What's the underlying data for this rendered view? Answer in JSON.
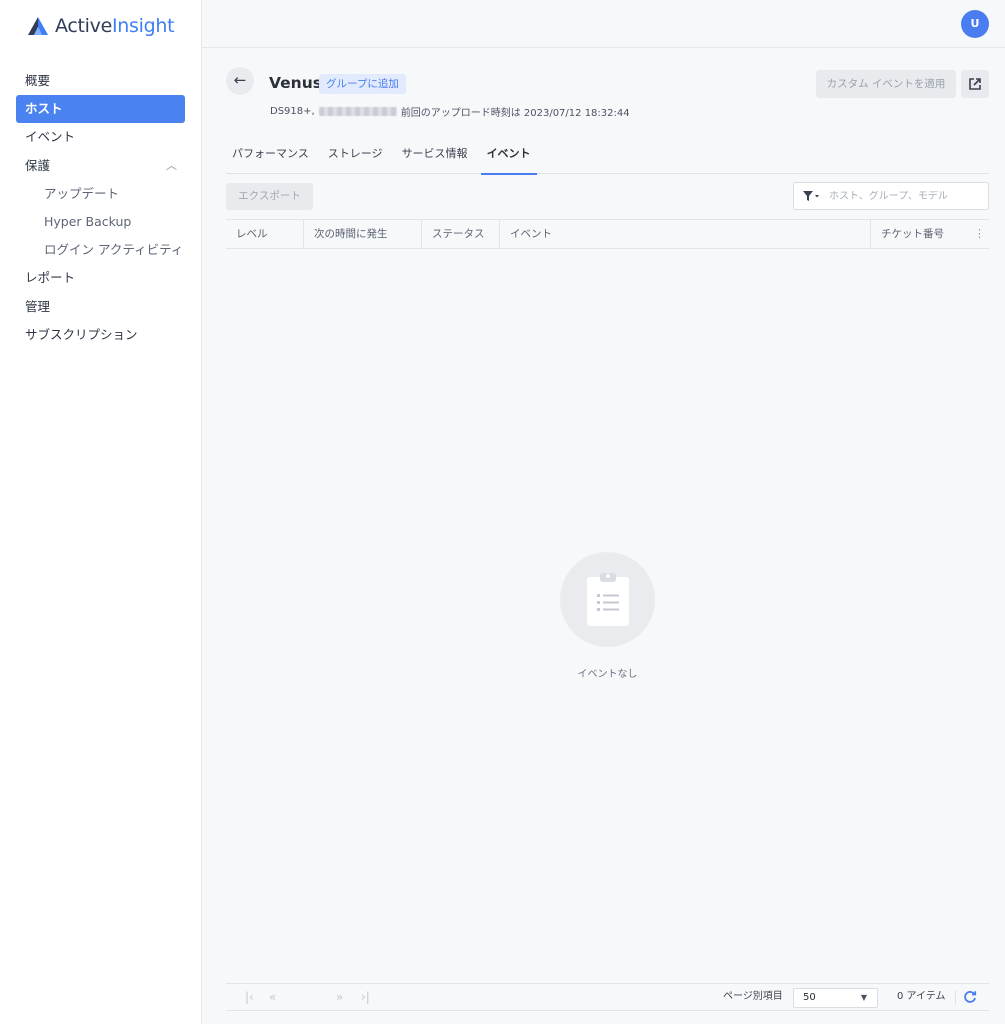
{
  "app": {
    "logo_part1": "Active",
    "logo_part2": "Insight",
    "accent": "#4a7df0"
  },
  "user": {
    "avatar_initial": "U"
  },
  "sidebar": {
    "items": [
      {
        "label": "概要"
      },
      {
        "label": "ホスト",
        "active": true
      },
      {
        "label": "イベント"
      },
      {
        "label": "保護",
        "expanded": true
      },
      {
        "label": "アップデート"
      },
      {
        "label": "Hyper Backup"
      },
      {
        "label": "ログイン アクティビティ"
      },
      {
        "label": "レポート"
      },
      {
        "label": "管理"
      },
      {
        "label": "サブスクリプション"
      }
    ]
  },
  "header": {
    "host_name": "Venus",
    "group_chip": "グループに追加",
    "model": "DS918+,",
    "last_upload": "前回のアップロード時刻は 2023/07/12 18:32:44",
    "custom_event_button": "カスタム イベントを適用"
  },
  "tabs": [
    {
      "label": "パフォーマンス"
    },
    {
      "label": "ストレージ"
    },
    {
      "label": "サービス情報"
    },
    {
      "label": "イベント",
      "active": true
    }
  ],
  "toolbar": {
    "export_label": "エクスポート",
    "search_placeholder": "ホスト、グループ、モデル"
  },
  "table": {
    "columns": [
      {
        "label": "レベル"
      },
      {
        "label": "次の時間に発生"
      },
      {
        "label": "ステータス"
      },
      {
        "label": "イベント"
      },
      {
        "label": "チケット番号"
      }
    ],
    "rows": []
  },
  "empty_state": {
    "text": "イベントなし"
  },
  "pagination": {
    "per_page_label": "ページ別項目",
    "per_page_value": "50",
    "item_count": "0 アイテム"
  }
}
